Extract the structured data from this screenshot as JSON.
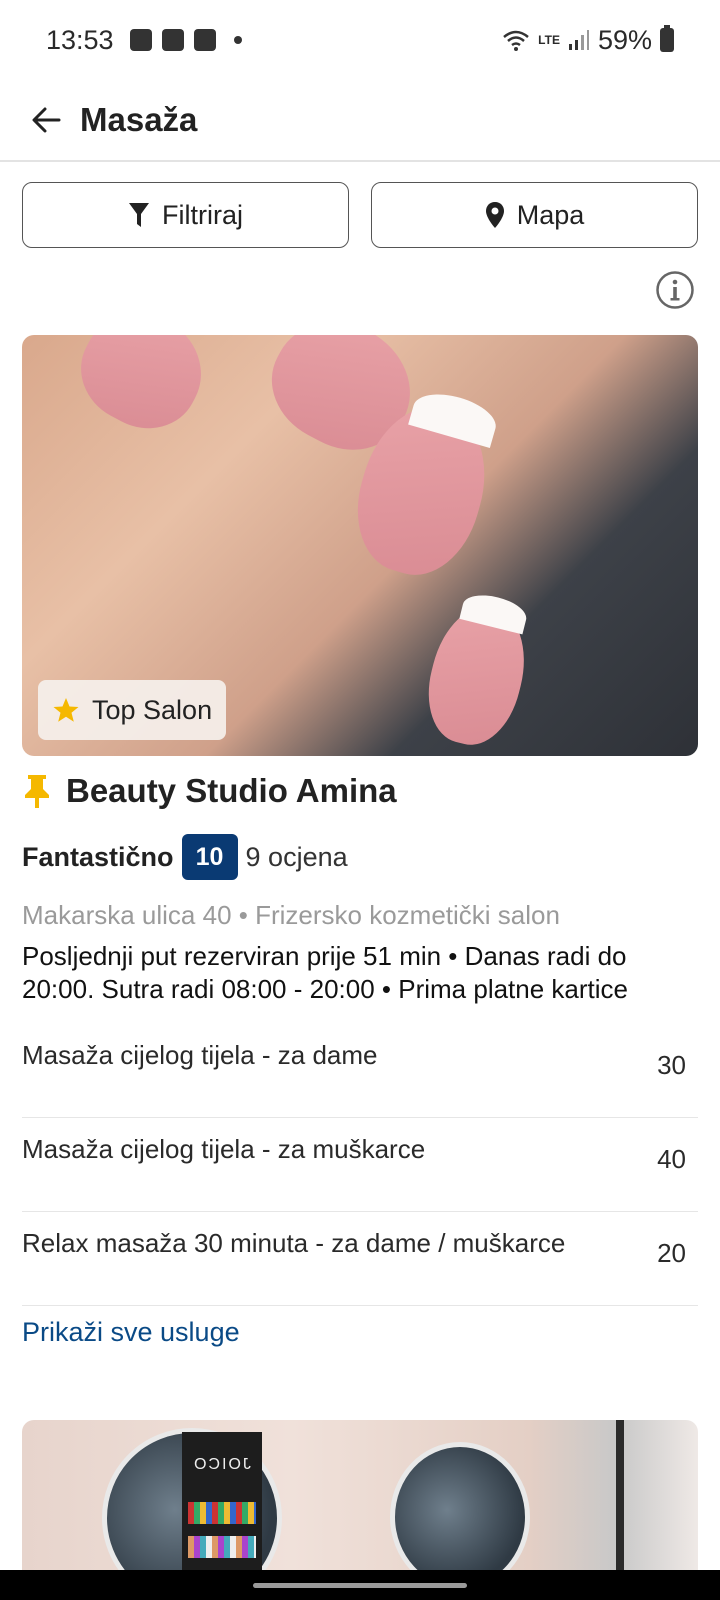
{
  "status_bar": {
    "time": "13:53",
    "network_label": "LTE",
    "battery": "59%",
    "icons": [
      "gallery-icon",
      "calendar-icon",
      "shop-icon",
      "wifi-icon",
      "volte-icon",
      "signal-icon",
      "battery-icon"
    ]
  },
  "app_bar": {
    "title": "Masaža",
    "back_icon": "arrow-left-icon"
  },
  "toolbar": {
    "filter_label": "Filtriraj",
    "filter_icon": "filter-icon",
    "map_label": "Mapa",
    "map_icon": "location-pin-icon",
    "info_icon": "info-icon"
  },
  "listing": {
    "badge_label": "Top Salon",
    "badge_icon": "star-icon",
    "badge_color": "#f5b800",
    "pin_icon": "pushpin-icon",
    "pin_color": "#f5b800",
    "name": "Beauty Studio Amina",
    "rating_word": "Fantastično",
    "rating_score": "10",
    "rating_color": "#0a3a73",
    "reviews": "9 ocjena",
    "address": "Makarska ulica 40 • Frizersko kozmetički salon",
    "info": "Posljednji put rezerviran prije 51 min • Danas radi do 20:00. Sutra radi 08:00 - 20:00 • Prima platne kartice",
    "services": [
      {
        "name": "Masaža cijelog tijela - za dame",
        "price": "30"
      },
      {
        "name": "Masaža cijelog tijela - za muškarce",
        "price": "40"
      },
      {
        "name": "Relax masaža 30 minuta - za dame / muškarce",
        "price": "20"
      }
    ],
    "show_all": "Prikaži sve usluge",
    "link_color": "#0a4a86"
  },
  "next_listing": {
    "sign_text": "JOICO"
  }
}
